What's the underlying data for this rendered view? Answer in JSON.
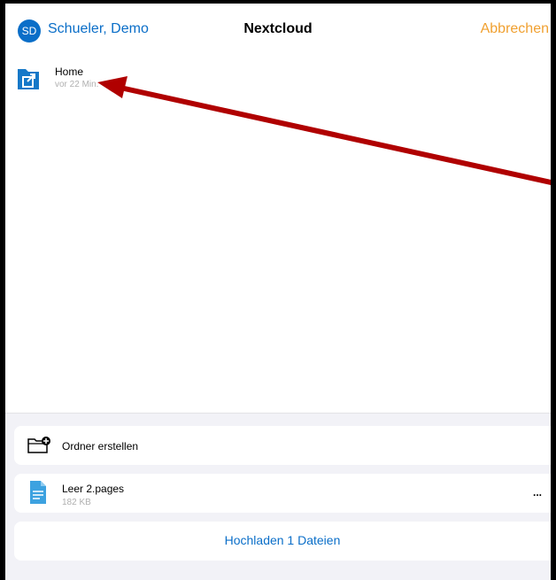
{
  "header": {
    "avatar_initials": "SD",
    "account_name": "Schueler, Demo",
    "title": "Nextcloud",
    "cancel_label": "Abbrechen"
  },
  "folder": {
    "name": "Home",
    "subtitle": "vor 22 Min."
  },
  "actions": {
    "create_folder_label": "Ordner erstellen"
  },
  "file": {
    "name": "Leer 2.pages",
    "size": "182 KB",
    "more_label": "..."
  },
  "upload": {
    "label": "Hochladen 1 Dateien"
  },
  "colors": {
    "accent_blue": "#0a6ec8",
    "cancel_orange": "#f0a030",
    "annotation_red": "#b00000"
  }
}
